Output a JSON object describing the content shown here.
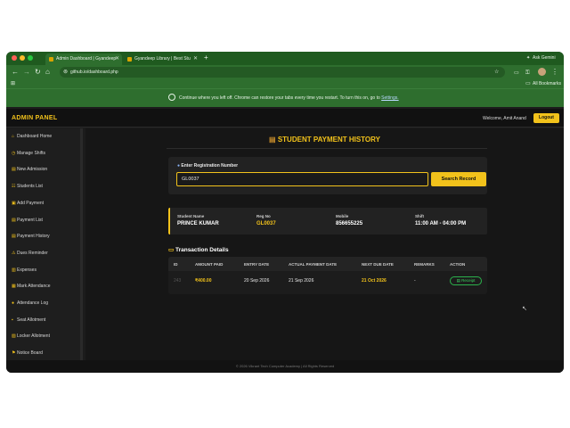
{
  "browser": {
    "tabs": [
      {
        "label": "Admin Dashboard | Gyandeep"
      },
      {
        "label": "Gyandeep Library | Best Stu"
      }
    ],
    "new_tab": "+",
    "ask_label": "Ask Gemini",
    "url": "github.io/dashboard.php",
    "all_bookmarks": "All Bookmarks",
    "infobar_text": "Continue where you left off. Chrome can restore your tabs every time you restart. To turn this on, go to",
    "infobar_link": "Settings."
  },
  "header": {
    "brand": "ADMIN PANEL",
    "welcome": "Welcome, Amit Anand",
    "logout": "Logout"
  },
  "sidebar": {
    "items": [
      {
        "label": "Dashboard Home",
        "icon": "home-icon",
        "glyph": "⌂"
      },
      {
        "label": "Manage Shifts",
        "icon": "clock-icon",
        "glyph": "◷"
      },
      {
        "label": "New Admission",
        "icon": "form-icon",
        "glyph": "▤"
      },
      {
        "label": "Students List",
        "icon": "users-icon",
        "glyph": "☷"
      },
      {
        "label": "Add Payment",
        "icon": "money-icon",
        "glyph": "▣"
      },
      {
        "label": "Payment List",
        "icon": "list-icon",
        "glyph": "▤"
      },
      {
        "label": "Payment History",
        "icon": "history-icon",
        "glyph": "▤"
      },
      {
        "label": "Dues Reminder",
        "icon": "warning-icon",
        "glyph": "⚠"
      },
      {
        "label": "Expenses",
        "icon": "expense-icon",
        "glyph": "▥"
      },
      {
        "label": "Mark Attendance",
        "icon": "attendance-icon",
        "glyph": "▦"
      },
      {
        "label": "Attendance Log",
        "icon": "log-icon",
        "glyph": "●"
      },
      {
        "label": "Seat Allotment",
        "icon": "seat-icon",
        "glyph": "▪"
      },
      {
        "label": "Locker Allotment",
        "icon": "locker-icon",
        "glyph": "▧"
      },
      {
        "label": "Notice Board",
        "icon": "notice-icon",
        "glyph": "⚑"
      }
    ]
  },
  "main": {
    "title": "STUDENT PAYMENT HISTORY",
    "search_label": "Enter Registration Number",
    "reg_value": "GL0037",
    "search_button": "Search Record",
    "student": {
      "name_label": "Student Name",
      "name": "PRINCE KUMAR",
      "reg_label": "Reg No",
      "reg": "GL0037",
      "mobile_label": "Mobile",
      "mobile": "856655225",
      "shift_label": "Shift",
      "shift": "11:00 AM - 04:00 PM"
    },
    "transactions_title": "Transaction Details",
    "columns": [
      "ID",
      "AMOUNT PAID",
      "ENTRY DATE",
      "ACTUAL PAYMENT DATE",
      "NEXT DUE DATE",
      "REMARKS",
      "ACTION"
    ],
    "rows": [
      {
        "id": "243",
        "amount": "₹400.00",
        "entry_date": "20 Sep 2026",
        "actual_date": "21 Sep 2026",
        "next_due": "21 Oct 2026",
        "remarks": "-",
        "action": "Receipt"
      }
    ]
  },
  "footer": "© 2026 Vikrant Tech Computer Academy | All Rights Reserved",
  "colors": {
    "accent": "#f2c21b",
    "chrome_green": "#2e6e2e",
    "success": "#2bb24c"
  }
}
